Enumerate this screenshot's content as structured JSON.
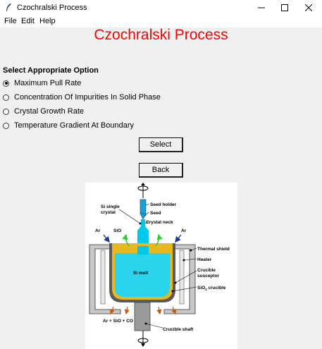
{
  "window": {
    "title": "Czochralski Process",
    "minimize_glyph": "—",
    "maximize_glyph": "☐",
    "close_glyph": "✕"
  },
  "menubar": {
    "items": [
      "File",
      "Edit",
      "Help"
    ]
  },
  "main": {
    "heading": "Czochralski Process",
    "prompt": "Select Appropriate Option",
    "options": [
      {
        "label": "Maximum Pull Rate",
        "selected": true
      },
      {
        "label": "Concentration Of Impurities In Solid Phase",
        "selected": false
      },
      {
        "label": "Crystal Growth Rate",
        "selected": false
      },
      {
        "label": "Temperature Gradient At Boundary",
        "selected": false
      }
    ],
    "select_label": "Select",
    "back_label": "Back"
  },
  "diagram": {
    "labels": {
      "si_single": "Si single",
      "crystal": "crystal",
      "seed_holder": "Seed holder",
      "seed": "Seed",
      "crystal_neck": "Crystal neck",
      "ar_left": "Ar",
      "sio": "SiO",
      "ar_right": "Ar",
      "thermal_shield": "Thermal shield",
      "heater": "Heater",
      "crucible": "Crucible",
      "susceptor": "susceptor",
      "si_melt": "Si melt",
      "sio2_crucible": "SiO",
      "sio2_sub": "2",
      "sio2_suffix": " crucible",
      "exhaust": "Ar + SiO + CO",
      "crucible_shaft": "Crucible shaft"
    },
    "colors": {
      "crystal": "#00c8e8",
      "melt": "#29d4ec",
      "crucible": "#e8b820",
      "insulation": "#c8c8c8",
      "shaft": "#9a9a9a"
    }
  }
}
